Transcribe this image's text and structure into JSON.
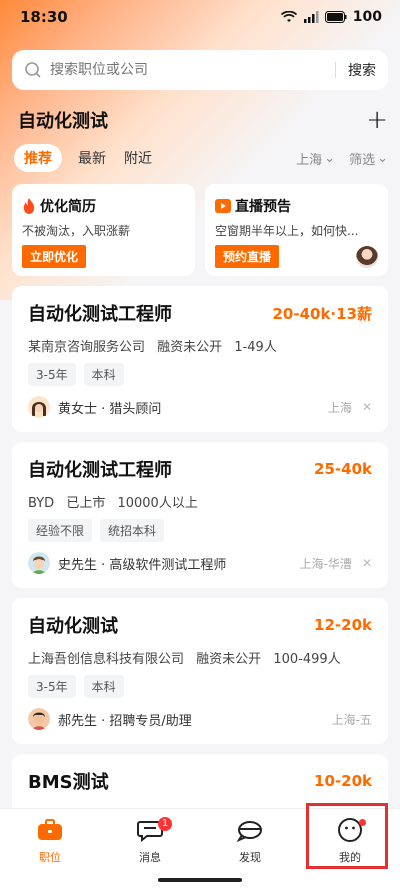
{
  "status_bar": {
    "time": "18:30",
    "battery": "100"
  },
  "search": {
    "placeholder": "搜索职位或公司",
    "button_label": "搜索"
  },
  "header": {
    "title": "自动化测试"
  },
  "tabs": [
    {
      "label": "推荐",
      "active": true
    },
    {
      "label": "最新",
      "active": false
    },
    {
      "label": "附近",
      "active": false
    }
  ],
  "filters": {
    "city": "上海",
    "filter": "筛选"
  },
  "promos": [
    {
      "title": "优化简历",
      "desc": "不被淘汰，入职涨薪",
      "button": "立即优化",
      "icon": "fire-icon"
    },
    {
      "title": "直播预告",
      "desc": "空窗期半年以上，如何快...",
      "button": "预约直播",
      "icon": "play-icon"
    }
  ],
  "jobs": [
    {
      "title": "自动化测试工程师",
      "salary": "20-40k·13薪",
      "company": "某南京咨询服务公司",
      "funding": "融资未公开",
      "size": "1-49人",
      "tags": [
        "3-5年",
        "本科"
      ],
      "recruiter": "黄女士 · 猎头顾问",
      "location": "上海"
    },
    {
      "title": "自动化测试工程师",
      "salary": "25-40k",
      "company": "BYD",
      "funding": "已上市",
      "size": "10000人以上",
      "tags": [
        "经验不限",
        "统招本科"
      ],
      "recruiter": "史先生 · 高级软件测试工程师",
      "location": "上海-华漕"
    },
    {
      "title": "自动化测试",
      "salary": "12-20k",
      "company": "上海吾创信息科技有限公司",
      "funding": "融资未公开",
      "size": "100-499人",
      "tags": [
        "3-5年",
        "本科"
      ],
      "recruiter": "郝先生 · 招聘专员/助理",
      "location": "上海-五"
    },
    {
      "title": "BMS测试",
      "salary": "10-20k",
      "company": "",
      "funding": "",
      "size": "",
      "tags": [],
      "recruiter": "",
      "location": ""
    }
  ],
  "nav": [
    {
      "label": "职位",
      "icon": "briefcase-icon",
      "active": true
    },
    {
      "label": "消息",
      "icon": "chat-icon",
      "badge": "1"
    },
    {
      "label": "发现",
      "icon": "discover-icon"
    },
    {
      "label": "我的",
      "icon": "profile-icon"
    }
  ],
  "colors": {
    "accent": "#ff6a00",
    "highlight": "#e53030"
  }
}
